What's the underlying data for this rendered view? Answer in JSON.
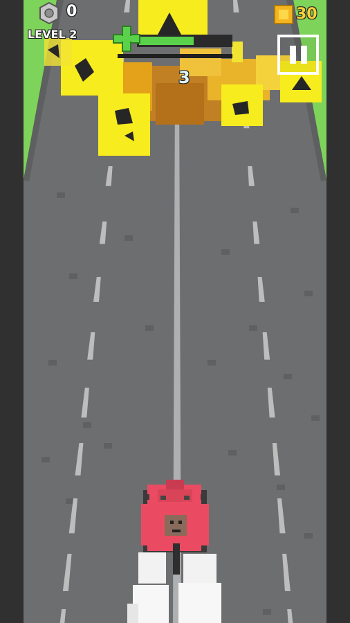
{
  "hud": {
    "bolts_count": "0",
    "level_label": "LEVEL 2",
    "coins_count": "30",
    "combo_count": "3",
    "health_fraction": 0.6,
    "pause_label": "Pause"
  },
  "colors": {
    "road": "#6d6e70",
    "grass": "#7ed35a",
    "lane_mark": "#bdbdbd",
    "block_yellow": "#f7ec1e",
    "block_orange": "#d88a17",
    "player_red": "#ea4b62",
    "health_green": "#5ad14a",
    "smoke": "#f2f2f2"
  },
  "icons": {
    "bolt": "hex-bolt-icon",
    "coin": "coin-block-icon",
    "health": "plus-health-icon",
    "pause": "pause-icon"
  }
}
